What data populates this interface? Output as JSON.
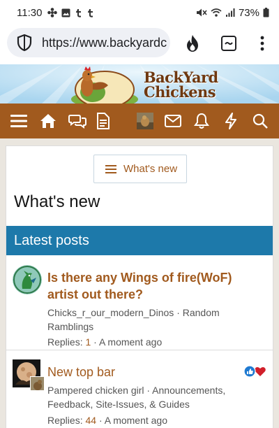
{
  "status_bar": {
    "time": "11:30",
    "battery": "73%"
  },
  "browser": {
    "url": "https://www.backyardc"
  },
  "banner": {
    "logo_line1": "BackYard",
    "logo_line2": "Chickens"
  },
  "page": {
    "whats_new_button": "What's new",
    "title": "What's new",
    "block_header": "Latest posts"
  },
  "threads": [
    {
      "title": "Is there any Wings of fire(WoF) artist out there?",
      "meta": "Chicks_r_our_modern_Dinos · Random Ramblings",
      "replies_label": "Replies:",
      "replies": "1",
      "time": "· A moment ago"
    },
    {
      "title": "New top bar",
      "meta": "Pampered chicken girl · Announcements, Feedback, Site-Issues, & Guides",
      "replies_label": "Replies:",
      "replies": "44",
      "time": "· A moment ago"
    }
  ],
  "colors": {
    "nav_brown": "#a15a1e",
    "header_blue": "#1d79aa",
    "link_brown": "#a15a1e"
  }
}
